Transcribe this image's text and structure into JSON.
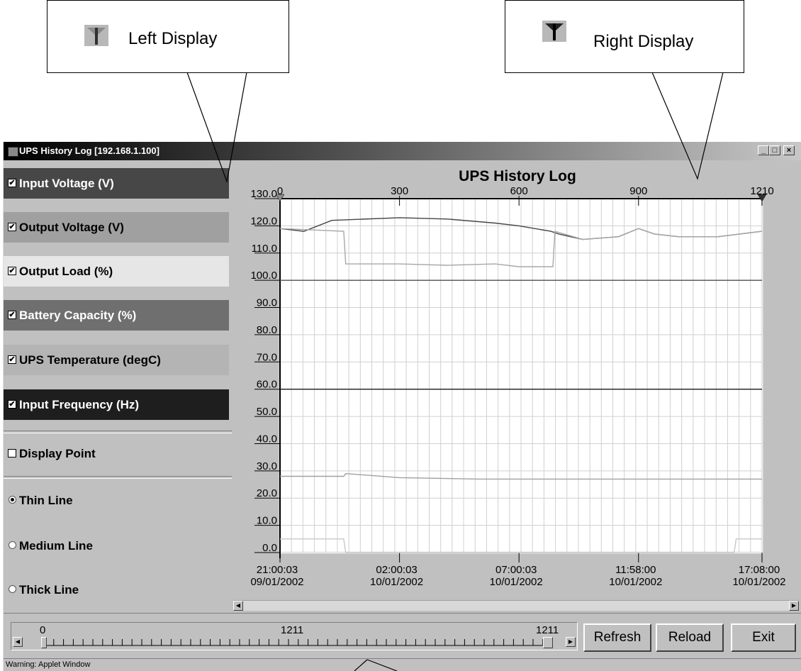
{
  "callouts": {
    "left_label": "Left Display",
    "right_label": "Right Display",
    "icon": "marker-icon"
  },
  "window": {
    "title": "UPS History Log [192.168.1.100]",
    "min": "_",
    "max": "□",
    "close": "×"
  },
  "series": [
    {
      "label": "Input Voltage (V)",
      "checked": true,
      "bg": "#474747",
      "fg": "#ffffff"
    },
    {
      "label": "Output Voltage (V)",
      "checked": true,
      "bg": "#a0a0a0",
      "fg": "#000000"
    },
    {
      "label": "Output Load  (%)",
      "checked": true,
      "bg": "#e6e6e6",
      "fg": "#000000"
    },
    {
      "label": "Battery Capacity (%)",
      "checked": true,
      "bg": "#6f6f6f",
      "fg": "#ffffff"
    },
    {
      "label": "UPS Temperature (degC)",
      "checked": true,
      "bg": "#b4b4b4",
      "fg": "#000000"
    },
    {
      "label": "Input Frequency (Hz)",
      "checked": true,
      "bg": "#1e1e1e",
      "fg": "#ffffff"
    }
  ],
  "options": {
    "display_point": "Display Point",
    "thin": "Thin Line",
    "medium": "Medium Line",
    "thick": "Thick Line",
    "selected_line": "Thin Line"
  },
  "chart_data": {
    "type": "line",
    "title": "UPS History Log",
    "top_axis_ticks": [
      "0",
      "300",
      "600",
      "900",
      "1210"
    ],
    "top_axis_values": [
      0,
      300,
      600,
      900,
      1210
    ],
    "y_ticks": [
      "130.0",
      "120.0",
      "110.0",
      "100.0",
      "90.0",
      "80.0",
      "70.0",
      "60.0",
      "50.0",
      "40.0",
      "30.0",
      "20.0",
      "10.0",
      "0.0"
    ],
    "ylim": [
      0,
      130
    ],
    "xlim": [
      0,
      1210
    ],
    "x_time_labels": [
      {
        "time": "21:00:03",
        "date": "09/01/2002",
        "index": 0
      },
      {
        "time": "02:00:03",
        "date": "10/01/2002",
        "index": 300
      },
      {
        "time": "07:00:03",
        "date": "10/01/2002",
        "index": 600
      },
      {
        "time": "11:58:00",
        "date": "10/01/2002",
        "index": 900
      },
      {
        "time": "17:08:00",
        "date": "10/01/2002",
        "index": 1210
      }
    ],
    "grid": true,
    "series": [
      {
        "color": "#454545",
        "points": [
          [
            0,
            119
          ],
          [
            60,
            118
          ],
          [
            130,
            122
          ],
          [
            300,
            123
          ],
          [
            420,
            122.5
          ],
          [
            540,
            121
          ],
          [
            600,
            120
          ],
          [
            680,
            118
          ],
          [
            700,
            117
          ],
          [
            760,
            115
          ],
          [
            850,
            116
          ],
          [
            900,
            119
          ],
          [
            940,
            117
          ],
          [
            1000,
            116
          ],
          [
            1100,
            116
          ],
          [
            1210,
            118
          ]
        ]
      },
      {
        "color": "#a8a8a8",
        "points": [
          [
            0,
            119
          ],
          [
            160,
            118
          ],
          [
            165,
            106
          ],
          [
            300,
            106
          ],
          [
            420,
            105.5
          ],
          [
            540,
            106
          ],
          [
            600,
            105
          ],
          [
            685,
            105
          ],
          [
            690,
            118
          ],
          [
            760,
            115
          ],
          [
            850,
            116
          ],
          [
            900,
            119
          ],
          [
            940,
            117
          ],
          [
            1000,
            116
          ],
          [
            1100,
            116
          ],
          [
            1210,
            118
          ]
        ]
      },
      {
        "color": "#505050",
        "points": [
          [
            0,
            100
          ],
          [
            1210,
            100
          ]
        ]
      },
      {
        "color": "#1a1a1a",
        "points": [
          [
            0,
            60
          ],
          [
            1210,
            60
          ]
        ]
      },
      {
        "color": "#a0a0a0",
        "points": [
          [
            0,
            28
          ],
          [
            160,
            28
          ],
          [
            165,
            29
          ],
          [
            300,
            27.5
          ],
          [
            500,
            27
          ],
          [
            700,
            27
          ],
          [
            850,
            27
          ],
          [
            1210,
            27
          ]
        ]
      },
      {
        "color": "#c8c8c8",
        "points": [
          [
            0,
            5
          ],
          [
            160,
            5
          ],
          [
            165,
            0
          ],
          [
            1140,
            0
          ],
          [
            1145,
            5
          ],
          [
            1210,
            5
          ]
        ]
      }
    ]
  },
  "slider": {
    "min_label": "0",
    "mid_label": "1211",
    "max_label": "1211",
    "value": 1211,
    "max": 1211
  },
  "buttons": {
    "refresh": "Refresh",
    "reload": "Reload",
    "exit": "Exit"
  },
  "status": "Warning: Applet Window"
}
